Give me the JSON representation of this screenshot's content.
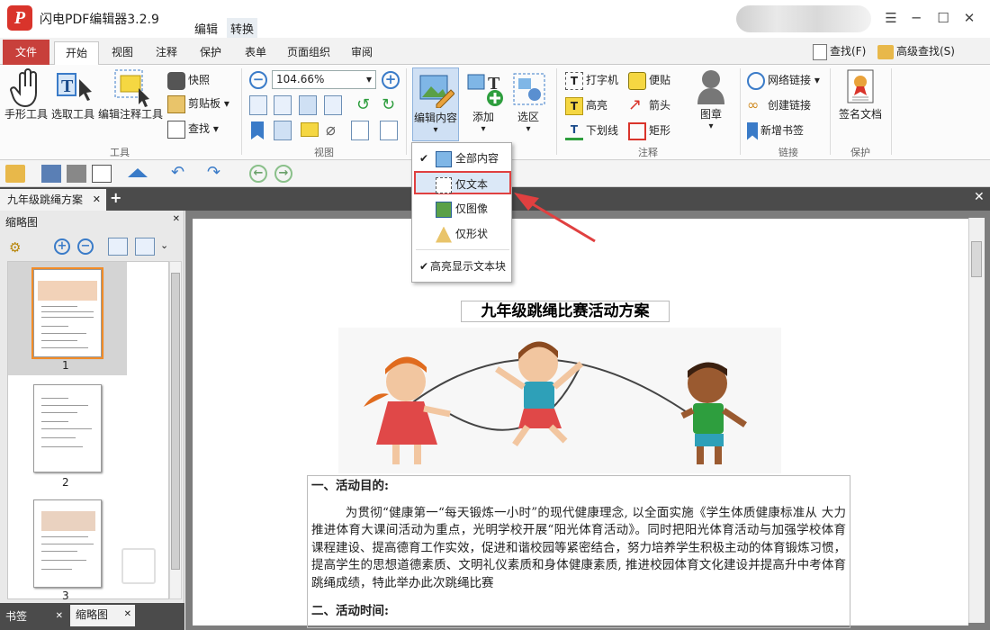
{
  "app": {
    "logo_letter": "P",
    "title": "闪电PDF编辑器3.2.9",
    "top_menus": [
      "编辑",
      "转换"
    ],
    "window_buttons": [
      "☰",
      "─",
      "☐",
      "✕"
    ]
  },
  "ribbon_tabs": [
    "文件",
    "开始",
    "视图",
    "注释",
    "保护",
    "表单",
    "页面组织",
    "审阅"
  ],
  "ribbon_right": {
    "find": "查找(F)",
    "advanced_find": "高级查找(S)"
  },
  "groups": {
    "tools": {
      "label": "工具",
      "buttons": [
        "手形工具",
        "选取工具",
        "编辑注释工具"
      ],
      "small": [
        "快照",
        "剪贴板",
        "查找"
      ]
    },
    "view": {
      "label": "视图",
      "zoom": "104.66%"
    },
    "content": {
      "edit_content": "编辑内容",
      "add": "添加",
      "select_area": "选区"
    },
    "annotation": {
      "label": "注释",
      "items": [
        "打字机",
        "便贴",
        "高亮",
        "箭头",
        "下划线",
        "矩形"
      ],
      "stamp": "图章"
    },
    "link": {
      "label": "链接",
      "items": [
        "网络链接",
        "创建链接",
        "新增书签"
      ]
    },
    "protect": {
      "label": "保护",
      "sign": "签名文档"
    }
  },
  "dropdown": {
    "items": [
      "全部内容",
      "仅文本",
      "仅图像",
      "仅形状"
    ],
    "highlight_option": "高亮显示文本块",
    "selected": "仅文本"
  },
  "doc_tab": "九年级跳绳方案",
  "sidebar": {
    "title": "缩略图",
    "page_numbers": [
      "1",
      "2",
      "3"
    ],
    "bottom_tabs": [
      "书签",
      "缩略图"
    ]
  },
  "document": {
    "title": "九年级跳绳比赛活动方案",
    "section1": "一、活动目的:",
    "para1": "为贯彻“健康第一“每天锻炼一小时”的现代健康理念, 以全面实施《学生体质健康标准从 大力推进体育大课间活动为重点，光明学校开展“阳光体育活动》。同时把阳光体育活动与加强学校体育课程建设、提高德育工作实效，促进和谐校园等紧密结合，努力培养学生积极主动的体育锻炼习惯，提高学生的思想道德素质、文明礼仪素质和身体健康素质, 推进校园体育文化建设并提高升中考体育跳绳成绩，特此举办此次跳绳比赛",
    "section2": "二、活动时间:"
  },
  "colors": {
    "brand": "#d9342b",
    "file_tab": "#c8403b",
    "accent": "#3a7bc8",
    "highlight_border": "#e04040"
  }
}
